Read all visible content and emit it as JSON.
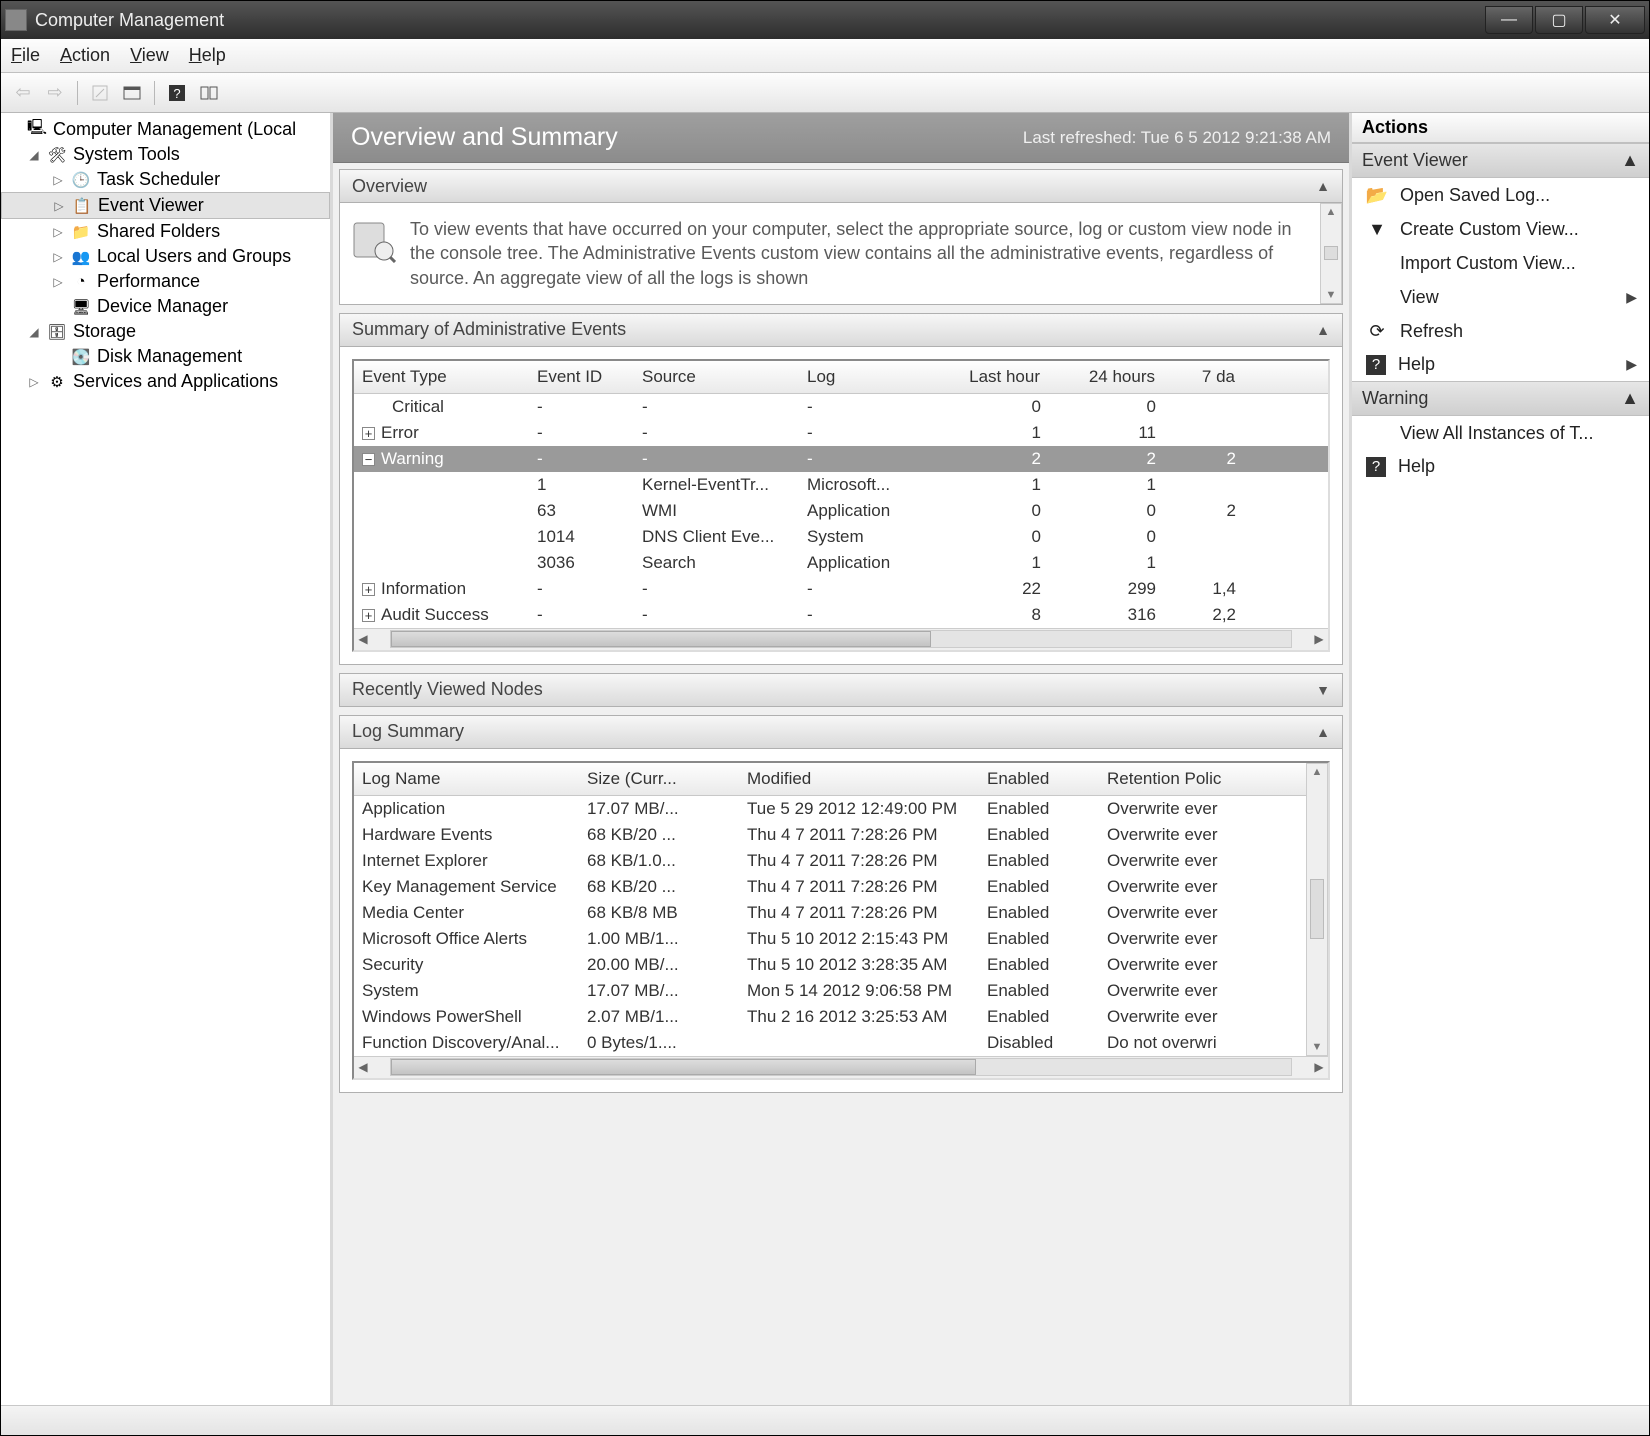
{
  "window": {
    "title": "Computer Management"
  },
  "menu": {
    "file": "File",
    "action": "Action",
    "view": "View",
    "help": "Help"
  },
  "tree": {
    "root": "Computer Management (Local",
    "systools": "System Tools",
    "task_scheduler": "Task Scheduler",
    "event_viewer": "Event Viewer",
    "shared_folders": "Shared Folders",
    "local_users": "Local Users and Groups",
    "performance": "Performance",
    "device_manager": "Device Manager",
    "storage": "Storage",
    "disk_management": "Disk Management",
    "services_apps": "Services and Applications"
  },
  "header": {
    "title": "Overview and Summary",
    "refreshed": "Last refreshed: Tue 6 5 2012 9:21:38 AM"
  },
  "overview": {
    "title": "Overview",
    "text": "To view events that have occurred on your computer, select the appropriate source, log or custom view node in the console tree. The Administrative Events custom view contains all the administrative events, regardless of source. An aggregate view of all the logs is shown"
  },
  "summary": {
    "title": "Summary of Administrative Events",
    "cols": {
      "type": "Event Type",
      "id": "Event ID",
      "src": "Source",
      "log": "Log",
      "hr": "Last hour",
      "h24": "24 hours",
      "d7": "7 da"
    },
    "rows": [
      {
        "twisty": "",
        "indent": true,
        "type": "Critical",
        "id": "-",
        "src": "-",
        "log": "-",
        "hr": "0",
        "h24": "0",
        "d7": ""
      },
      {
        "twisty": "+",
        "type": "Error",
        "id": "-",
        "src": "-",
        "log": "-",
        "hr": "1",
        "h24": "11",
        "d7": ""
      },
      {
        "twisty": "−",
        "type": "Warning",
        "id": "-",
        "src": "-",
        "log": "-",
        "hr": "2",
        "h24": "2",
        "d7": "2",
        "selected": true
      },
      {
        "child": true,
        "type": "",
        "id": "1",
        "src": "Kernel-EventTr...",
        "log": "Microsoft...",
        "hr": "1",
        "h24": "1",
        "d7": ""
      },
      {
        "child": true,
        "type": "",
        "id": "63",
        "src": "WMI",
        "log": "Application",
        "hr": "0",
        "h24": "0",
        "d7": "2"
      },
      {
        "child": true,
        "type": "",
        "id": "1014",
        "src": "DNS Client Eve...",
        "log": "System",
        "hr": "0",
        "h24": "0",
        "d7": ""
      },
      {
        "child": true,
        "type": "",
        "id": "3036",
        "src": "Search",
        "log": "Application",
        "hr": "1",
        "h24": "1",
        "d7": ""
      },
      {
        "twisty": "+",
        "type": "Information",
        "id": "-",
        "src": "-",
        "log": "-",
        "hr": "22",
        "h24": "299",
        "d7": "1,4"
      },
      {
        "twisty": "+",
        "type": "Audit Success",
        "id": "-",
        "src": "-",
        "log": "-",
        "hr": "8",
        "h24": "316",
        "d7": "2,2"
      }
    ]
  },
  "recently": {
    "title": "Recently Viewed Nodes"
  },
  "logsummary": {
    "title": "Log Summary",
    "cols": {
      "name": "Log Name",
      "size": "Size (Curr...",
      "mod": "Modified",
      "en": "Enabled",
      "ret": "Retention Polic"
    },
    "rows": [
      {
        "name": "Application",
        "size": "17.07 MB/...",
        "mod": "Tue 5 29 2012 12:49:00 PM",
        "en": "Enabled",
        "ret": "Overwrite ever"
      },
      {
        "name": "Hardware Events",
        "size": "68 KB/20 ...",
        "mod": "Thu 4 7 2011 7:28:26 PM",
        "en": "Enabled",
        "ret": "Overwrite ever"
      },
      {
        "name": "Internet Explorer",
        "size": "68 KB/1.0...",
        "mod": "Thu 4 7 2011 7:28:26 PM",
        "en": "Enabled",
        "ret": "Overwrite ever"
      },
      {
        "name": "Key Management Service",
        "size": "68 KB/20 ...",
        "mod": "Thu 4 7 2011 7:28:26 PM",
        "en": "Enabled",
        "ret": "Overwrite ever"
      },
      {
        "name": "Media Center",
        "size": "68 KB/8 MB",
        "mod": "Thu 4 7 2011 7:28:26 PM",
        "en": "Enabled",
        "ret": "Overwrite ever"
      },
      {
        "name": "Microsoft Office Alerts",
        "size": "1.00 MB/1...",
        "mod": "Thu 5 10 2012 2:15:43 PM",
        "en": "Enabled",
        "ret": "Overwrite ever"
      },
      {
        "name": "Security",
        "size": "20.00 MB/...",
        "mod": "Thu 5 10 2012 3:28:35 AM",
        "en": "Enabled",
        "ret": "Overwrite ever"
      },
      {
        "name": "System",
        "size": "17.07 MB/...",
        "mod": "Mon 5 14 2012 9:06:58 PM",
        "en": "Enabled",
        "ret": "Overwrite ever"
      },
      {
        "name": "Windows PowerShell",
        "size": "2.07 MB/1...",
        "mod": "Thu 2 16 2012 3:25:53 AM",
        "en": "Enabled",
        "ret": "Overwrite ever"
      },
      {
        "name": "Function Discovery/Anal...",
        "size": "0 Bytes/1....",
        "mod": "",
        "en": "Disabled",
        "ret": "Do not overwri"
      }
    ]
  },
  "actions": {
    "title": "Actions",
    "group1": "Event Viewer",
    "open_saved": "Open Saved Log...",
    "create_custom": "Create Custom View...",
    "import_custom": "Import Custom View...",
    "view": "View",
    "refresh": "Refresh",
    "help": "Help",
    "group2": "Warning",
    "view_all": "View All Instances of T...",
    "help2": "Help"
  }
}
